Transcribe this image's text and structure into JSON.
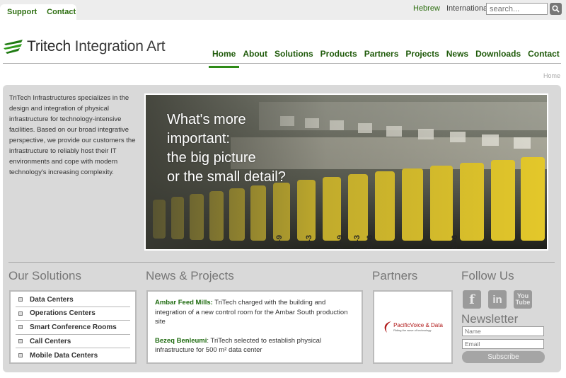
{
  "top": {
    "links": [
      "Support",
      "Contact"
    ],
    "lang_he": "Hebrew",
    "lang_intl": "International",
    "search_placeholder": "search..."
  },
  "logo": {
    "brand": "Tritech",
    "tagline": "Integration Art"
  },
  "nav": [
    "Home",
    "About",
    "Solutions",
    "Products",
    "Partners",
    "Projects",
    "News",
    "Downloads",
    "Contact"
  ],
  "breadcrumb": "Home",
  "intro": "TriTech Infrastructures specializes in the design and integration of physical infrastructure for technology-intensive facilities. Based on our broad integrative perspective, we provide our customers the infrastructure to reliably host their IT environments and cope with modern technology's increasing complexity.",
  "hero": {
    "lines": [
      "What's more",
      "important:",
      "the big picture",
      "or the small detail?"
    ]
  },
  "hero_tags": [
    "25-9",
    "26-3",
    "26-6",
    "24-9",
    "25-3",
    "25-6"
  ],
  "sections": {
    "solutions_title": "Our Solutions",
    "news_title": "News & Projects",
    "partners_title": "Partners",
    "follow_title": "Follow Us",
    "newsletter_title": "Newsletter"
  },
  "solutions": [
    "Data Centers",
    "Operations Centers",
    "Smart Conference Rooms",
    "Call Centers",
    "Mobile Data Centers"
  ],
  "news": [
    {
      "title": "Ambar Feed Mills:",
      "text": " TriTech charged with the building and integration of a new control room for the Ambar South production site"
    },
    {
      "title": "Bezeq Benleumi",
      "text": ": TriTech selected to establish physical infrastructure for 500 m² data center"
    }
  ],
  "partner": {
    "name": "PacificVoice & Data",
    "slogan": "Riding the wave of technology"
  },
  "social": {
    "facebook": "f",
    "linkedin": "in",
    "youtube_top": "You",
    "youtube_bottom": "Tube"
  },
  "newsletter": {
    "name_placeholder": "Name",
    "email_placeholder": "Email",
    "button": "Subscribe"
  },
  "colors": {
    "brand_green": "#2d6e10",
    "nav_green": "#1f5a0a",
    "panel_gray": "#d9d9d9"
  }
}
